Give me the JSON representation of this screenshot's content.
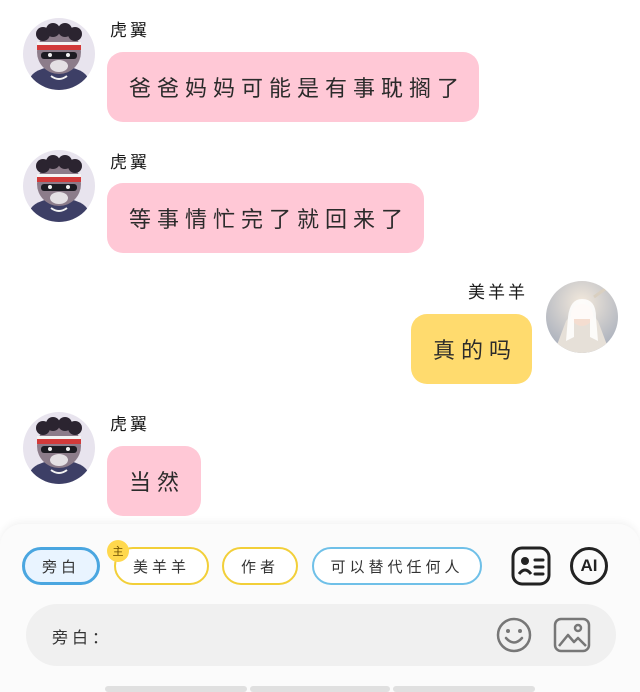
{
  "messages": [
    {
      "sender": "虎翼",
      "text": "爸爸妈妈可能是有事耽搁了"
    },
    {
      "sender": "虎翼",
      "text": "等事情忙完了就回来了"
    },
    {
      "sender": "美羊羊",
      "text": "真的吗"
    },
    {
      "sender": "虎翼",
      "text": "当然"
    }
  ],
  "roles": {
    "narration": "旁白",
    "meiyangyang": "美羊羊",
    "host_badge": "主",
    "author": "作者",
    "any_person": "可以替代任何人"
  },
  "icons": {
    "contact_card": "contact-card-icon",
    "ai": "AI",
    "emoji": "emoji-icon",
    "image": "image-icon"
  },
  "composer": {
    "label": "旁白：",
    "value": ""
  },
  "colors": {
    "pink_bubble": "#ffc8d6",
    "yellow_bubble": "#ffdb6e",
    "selected_chip": "#4aa6e0",
    "yellow_chip": "#f2cf39",
    "blue_chip": "#6fc0e8"
  }
}
